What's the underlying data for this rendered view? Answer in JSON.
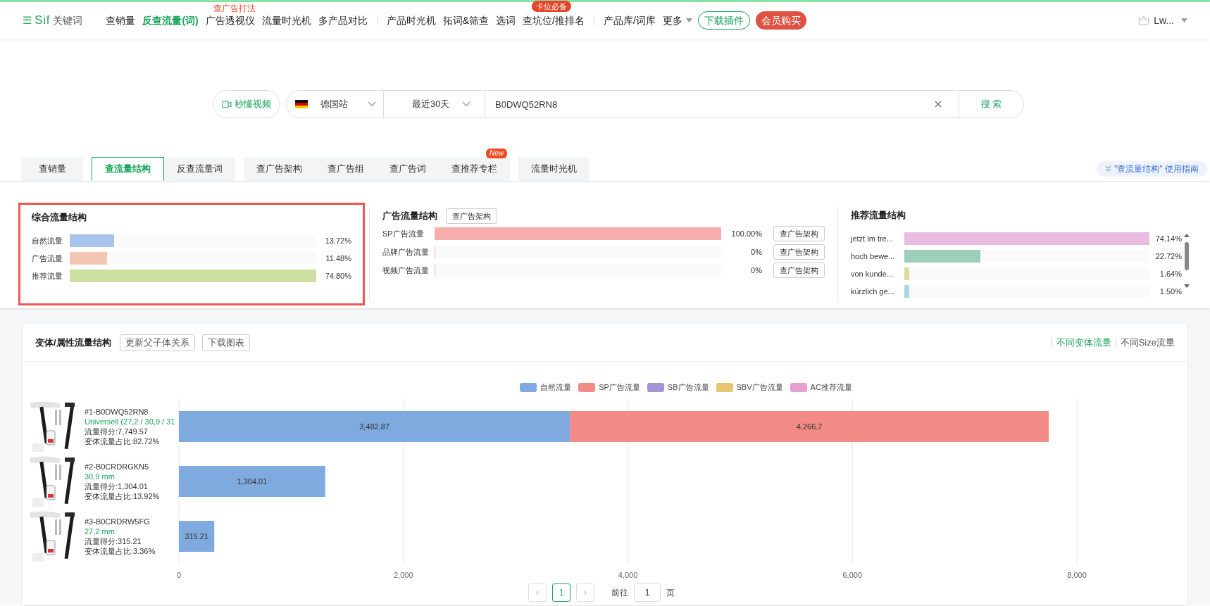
{
  "nav": {
    "logo_mark": "☰",
    "logo": "Sif",
    "logo_sub": "关键词",
    "groups": [
      [
        {
          "label": "查销量",
          "selected": false
        },
        {
          "label": "反查流量(词)",
          "selected": true
        },
        {
          "label": "广告透视仪",
          "selected": false,
          "note": "查广告打法"
        },
        {
          "label": "流量时光机",
          "selected": false
        },
        {
          "label": "多产品对比",
          "selected": false
        }
      ],
      [
        {
          "label": "产品时光机",
          "selected": false
        },
        {
          "label": "拓词&筛查",
          "selected": false
        },
        {
          "label": "选词",
          "selected": false
        },
        {
          "label": "查坑位/推排名",
          "selected": false,
          "tag": "卡位必备"
        }
      ],
      [
        {
          "label": "产品库/词库",
          "selected": false
        },
        {
          "label": "更多",
          "selected": false,
          "dropdown": true
        }
      ]
    ],
    "download": "下载插件",
    "vip": "会员购买",
    "user": "Lw..."
  },
  "search": {
    "video": "秒懂视频",
    "site": "德国站",
    "period": "最近30天",
    "query": "B0DWQ52RN8",
    "submit": "搜 索"
  },
  "tabs": {
    "groups": [
      [
        {
          "label": "查销量",
          "selected": false
        }
      ],
      [
        {
          "label": "查流量结构",
          "selected": true
        },
        {
          "label": "反查流量词",
          "selected": false
        }
      ],
      [
        {
          "label": "查广告架构",
          "selected": false
        },
        {
          "label": "查广告组",
          "selected": false
        },
        {
          "label": "查广告词",
          "selected": false
        },
        {
          "label": "查推荐专栏",
          "selected": false,
          "badge": "New"
        }
      ],
      [
        {
          "label": "流量时光机",
          "selected": false
        }
      ]
    ],
    "guide": "\"查流量结构\" 使用指南"
  },
  "composite": {
    "title": "综合流量结构",
    "highlighted": true,
    "rows": [
      {
        "label": "自然流量",
        "level": 0.18,
        "value": "13.72%",
        "color": "#a7c3ec"
      },
      {
        "label": "广告流量",
        "level": 0.15,
        "value": "11.48%",
        "color": "#f3c6b4"
      },
      {
        "label": "推荐流量",
        "level": 1.0,
        "value": "74.80%",
        "color": "#cde09f"
      }
    ]
  },
  "ads": {
    "title": "广告流量结构",
    "button": "查广告架构",
    "rows": [
      {
        "label": "SP广告流量",
        "level": 1.0,
        "value": "100.00%",
        "button": "查广告架构"
      },
      {
        "label": "品牌广告流量",
        "level": 0,
        "value": "0%",
        "button": "查广告架构"
      },
      {
        "label": "视频广告流量",
        "level": 0,
        "value": "0%",
        "button": "查广告架构"
      }
    ]
  },
  "recommend": {
    "title": "推荐流量结构",
    "rows": [
      {
        "label": "jetzt im tre...",
        "level": 1.0,
        "value": "74.14%",
        "color": "#e8bde0"
      },
      {
        "label": "hoch bewe...",
        "level": 0.31,
        "value": "22.72%",
        "color": "#9ccfba"
      },
      {
        "label": "von kunde...",
        "level": 0.02,
        "value": "1.64%",
        "color": "#dcdc9c"
      },
      {
        "label": "kürzlich ge...",
        "level": 0.02,
        "value": "1.50%",
        "color": "#a8d8e0"
      }
    ]
  },
  "variants": {
    "title": "变体/属性流量结构",
    "buttons": [
      "更新父子体关系",
      "下载图表"
    ],
    "views": [
      {
        "label": "不同变体流量",
        "selected": true
      },
      {
        "label": "不同Size流量",
        "selected": false
      }
    ],
    "products": [
      {
        "asin": "#1-B0DWQ52RN8",
        "variant": "Universell (27,2 / 30,9 / 31",
        "score": "流量得分:7,749.57",
        "share": "变体流量占比:82.72%"
      },
      {
        "asin": "#2-B0CRDRGKN5",
        "variant": "30,9 mm",
        "score": "流量得分:1,304.01",
        "share": "变体流量占比:13.92%"
      },
      {
        "asin": "#3-B0CRDRW5FG",
        "variant": "27,2 mm",
        "score": "流量得分:315.21",
        "share": "变体流量占比:3.36%"
      }
    ],
    "chart_data": {
      "type": "bar",
      "orientation": "horizontal",
      "stacked": true,
      "grid": true,
      "xlim": [
        0,
        8000
      ],
      "xticks": [
        {
          "value": 0,
          "label": "0"
        },
        {
          "value": 2000,
          "label": "2,000"
        },
        {
          "value": 4000,
          "label": "4,000"
        },
        {
          "value": 6000,
          "label": "6,000"
        },
        {
          "value": 8000,
          "label": "8,000"
        }
      ],
      "series": [
        {
          "name": "自然流量",
          "color": "#7faae0",
          "values": [
            3482.87,
            1304.01,
            315.21
          ],
          "value_labels": [
            "3,482.87",
            "1,304.01",
            "315.21"
          ]
        },
        {
          "name": "SP广告流量",
          "color": "#f28b86",
          "values": [
            4266.7,
            null,
            null
          ],
          "value_labels": [
            "4,266.7",
            null,
            null
          ]
        },
        {
          "name": "SB广告流量",
          "color": "#a294d6",
          "values": [
            null,
            null,
            null
          ]
        },
        {
          "name": "SBV广告流量",
          "color": "#e8c56f",
          "values": [
            null,
            null,
            null
          ]
        },
        {
          "name": "AC推荐流量",
          "color": "#e79fd3",
          "values": [
            null,
            null,
            null
          ]
        }
      ]
    }
  },
  "pagination": {
    "prev": "‹",
    "pages": [
      {
        "label": "1",
        "selected": true
      }
    ],
    "next": "›",
    "goto": "前往",
    "page_value": "1",
    "page_suffix": "页"
  }
}
